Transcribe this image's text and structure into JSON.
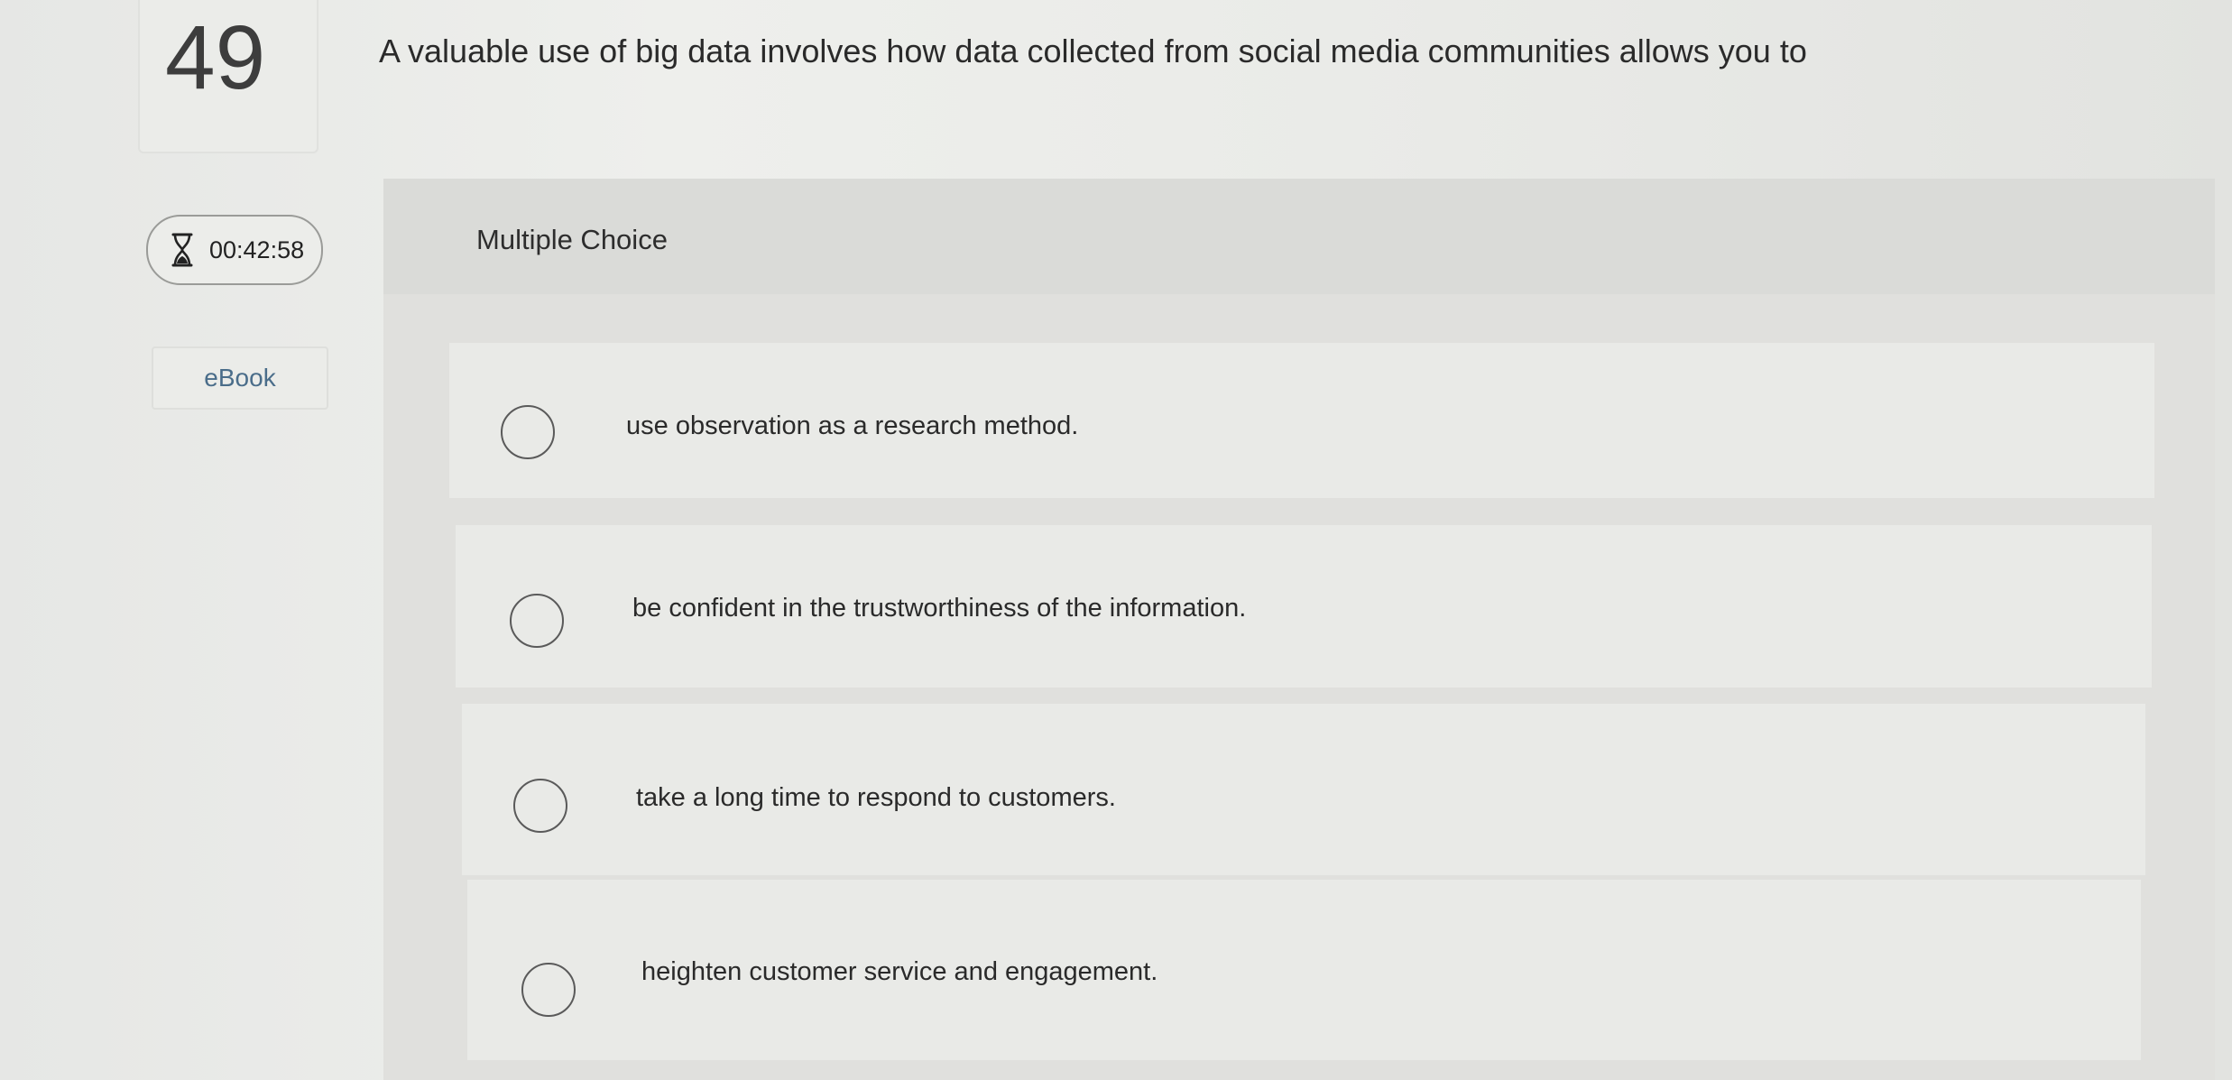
{
  "question": {
    "number": "49",
    "text": "A valuable use of big data involves how data collected from social media communities allows you to"
  },
  "timer": {
    "icon": "hourglass-icon",
    "value": "00:42:58"
  },
  "ebook": {
    "label": "eBook"
  },
  "question_type": "Multiple Choice",
  "options": [
    {
      "text": "use observation as a research method."
    },
    {
      "text": "be confident in the trustworthiness of the information."
    },
    {
      "text": "take a long time to respond to customers."
    },
    {
      "text": "heighten customer service and engagement."
    }
  ]
}
